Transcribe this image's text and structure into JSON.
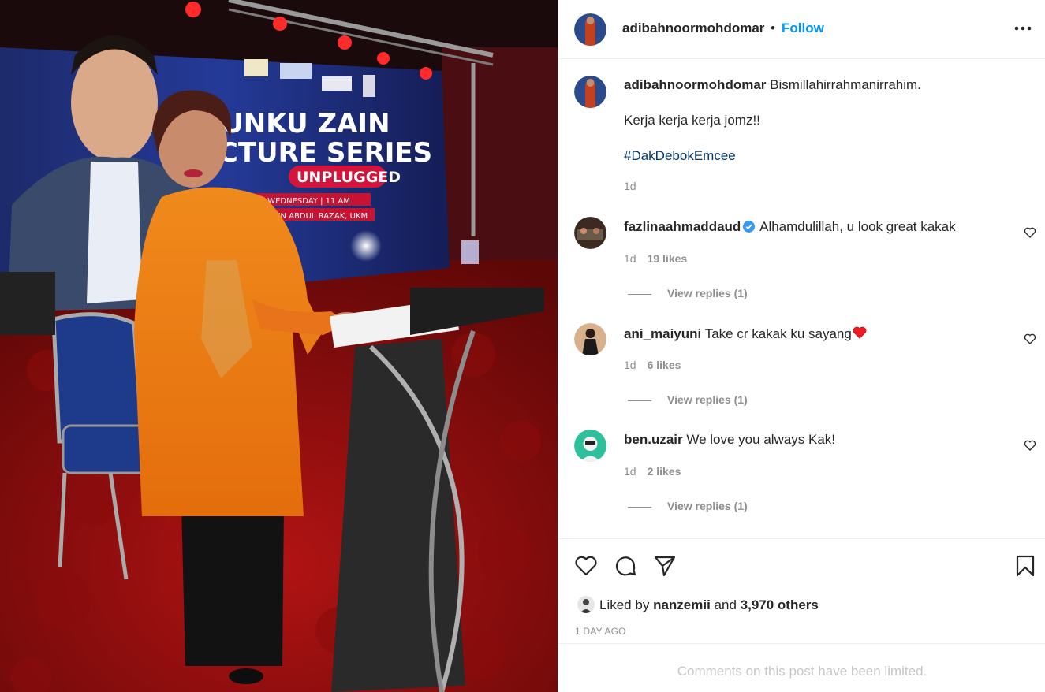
{
  "colors": {
    "accent": "#0095f6",
    "hashtag": "#00376b",
    "verified": "#3897f0",
    "heart": "#ed1c24"
  },
  "photo": {
    "alt_icon": "photo-of-woman-at-podium",
    "backdrop_texts": [
      "TUNKU ZAIN",
      "LECTURE SERIES",
      "UNPLUGGED",
      "2022 | WEDNESDAY | 11 AM",
      "TOR TUN ABDUL RAZAK, UKM"
    ]
  },
  "header": {
    "username": "adibahnoormohdomar",
    "separator": "•",
    "follow_label": "Follow",
    "more_icon": "more-horizontal-icon"
  },
  "caption": {
    "username": "adibahnoormohdomar",
    "text": "Bismillahirrahmanirrahim.",
    "line2": "Kerja kerja kerja jomz!!",
    "hashtag": "#DakDebokEmcee",
    "time": "1d"
  },
  "comments": [
    {
      "username": "fazlinaahmaddaud",
      "verified": true,
      "text": "Alhamdulillah, u look great kakak",
      "time": "1d",
      "likes": "19 likes",
      "replies": "View replies (1)"
    },
    {
      "username": "ani_maiyuni",
      "verified": false,
      "text": "Take cr kakak ku sayang",
      "emoji_icon": "red-heart-emoji",
      "time": "1d",
      "likes": "6 likes",
      "replies": "View replies (1)"
    },
    {
      "username": "ben.uzair",
      "verified": false,
      "text": "We love you always Kak!",
      "time": "1d",
      "likes": "2 likes",
      "replies": "View replies (1)"
    }
  ],
  "actions": {
    "like_icon": "heart-icon",
    "comment_icon": "comment-icon",
    "share_icon": "send-icon",
    "save_icon": "bookmark-icon"
  },
  "likes": {
    "prefix": "Liked by",
    "user": "nanzemii",
    "conj": "and",
    "others": "3,970 others"
  },
  "timestamp": "1 DAY AGO",
  "comments_limited": "Comments on this post have been limited."
}
